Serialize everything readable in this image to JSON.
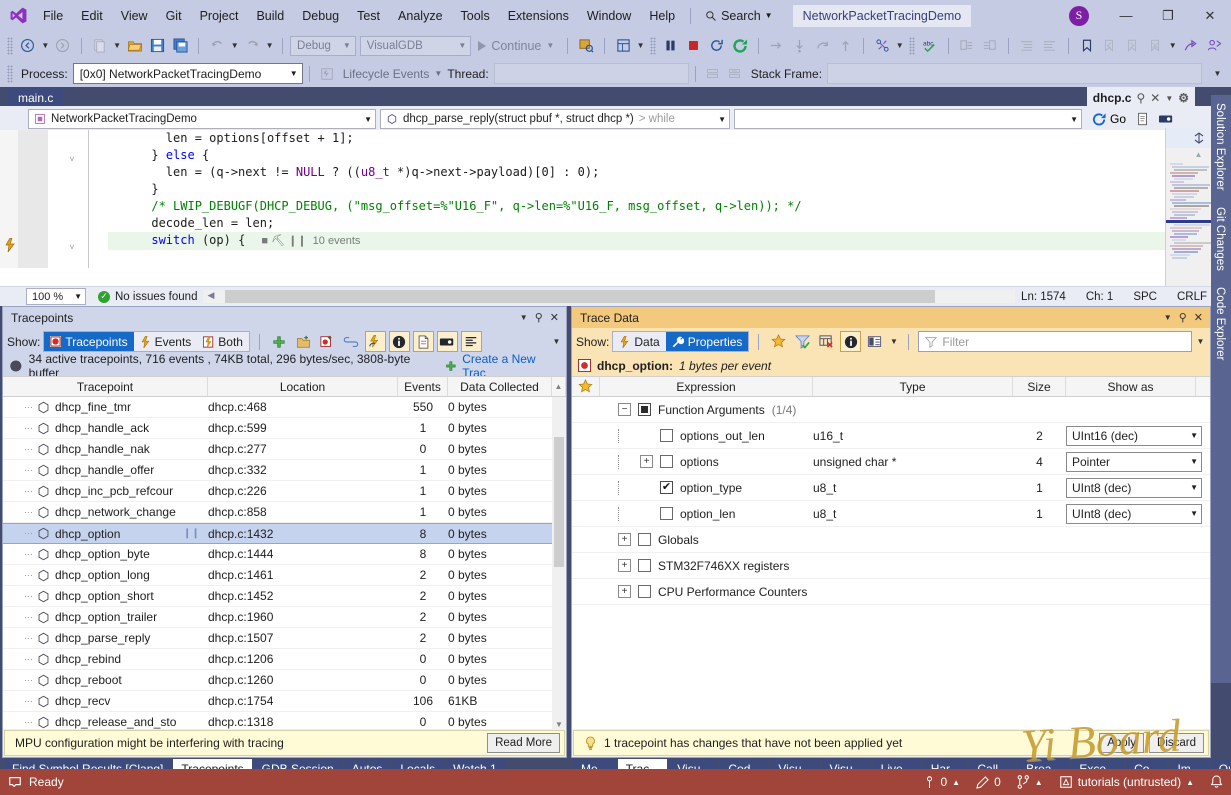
{
  "window": {
    "title": "NetworkPacketTracingDemo",
    "avatar_initial": "S",
    "minimize": "—",
    "restore": "❐",
    "close": "✕"
  },
  "menu": {
    "items": [
      "File",
      "Edit",
      "View",
      "Git",
      "Project",
      "Build",
      "Debug",
      "Test",
      "Analyze",
      "Tools",
      "Extensions",
      "Window",
      "Help"
    ],
    "search_label": "Search"
  },
  "toolbar": {
    "config": "Debug",
    "platform": "VisualGDB",
    "continue_label": "Continue",
    "icons": [
      "back-icon",
      "forward-icon",
      "new-item-icon",
      "open-file-icon",
      "save-icon",
      "save-all-icon",
      "undo-icon",
      "redo-icon",
      "pause-icon",
      "stop-icon",
      "restart-icon",
      "refresh-icon",
      "step-over-icon",
      "step-into-icon",
      "step-out-icon",
      "step-up-icon",
      "thread-icon",
      "spell-check-icon",
      "indent-icon",
      "outdent-icon",
      "comment-icon",
      "uncomment-icon",
      "bookmark-icon",
      "bookmark-prev-icon",
      "bookmark-next-icon",
      "bookmark-clear-icon",
      "share-icon",
      "live-share-icon"
    ]
  },
  "debug_bar": {
    "process_label": "Process:",
    "process_value": "[0x0] NetworkPacketTracingDemo",
    "lifecycle_label": "Lifecycle Events",
    "thread_label": "Thread:",
    "stack_frame_label": "Stack Frame:"
  },
  "editor": {
    "tabs": [
      {
        "label": "main.c",
        "active": true
      }
    ],
    "right_tab": "dhcp.c",
    "scope_project": "NetworkPacketTracingDemo",
    "scope_function": "dhcp_parse_reply(struct pbuf *, struct dhcp *)",
    "scope_suffix": "> while",
    "go_label": "Go",
    "code_lines": [
      {
        "indent": 8,
        "parts": [
          {
            "t": "len = options[offset + 1];",
            "c": ""
          }
        ]
      },
      {
        "indent": 6,
        "parts": [
          {
            "t": "} ",
            "c": ""
          },
          {
            "t": "else",
            "c": "kw"
          },
          {
            "t": " {",
            "c": ""
          }
        ]
      },
      {
        "indent": 8,
        "parts": [
          {
            "t": "len = (q->next != ",
            "c": ""
          },
          {
            "t": "NULL",
            "c": "macro"
          },
          {
            "t": " ? ((",
            "c": ""
          },
          {
            "t": "u8_t",
            "c": "macro"
          },
          {
            "t": " *)q->next->payload)[0] : 0);",
            "c": ""
          }
        ]
      },
      {
        "indent": 6,
        "parts": [
          {
            "t": "}",
            "c": ""
          }
        ]
      },
      {
        "indent": 6,
        "parts": [
          {
            "t": "/* LWIP_DEBUGF(DHCP_DEBUG, (\"msg_offset=%\"U16_F\", q->len=%\"U16_F, msg_offset, q->len)); */",
            "c": "cmt"
          }
        ]
      },
      {
        "indent": 6,
        "parts": [
          {
            "t": "decode_len = len;",
            "c": ""
          }
        ]
      },
      {
        "indent": 6,
        "highlight": true,
        "parts": [
          {
            "t": "switch",
            "c": "kw"
          },
          {
            "t": " (op) {",
            "c": ""
          }
        ]
      }
    ],
    "inline_events": "10 events",
    "zoom": "100 %",
    "issues": "No issues found",
    "ln": "Ln: 1574",
    "ch": "Ch: 1",
    "spaces": "SPC",
    "eol": "CRLF"
  },
  "tracepoints_panel": {
    "title": "Tracepoints",
    "show_label": "Show:",
    "segments": [
      {
        "label": "Tracepoints",
        "icon": "tracepoint-icon",
        "active": true
      },
      {
        "label": "Events",
        "icon": "lightning-icon",
        "active": false
      },
      {
        "label": "Both",
        "icon": "both-icon",
        "active": false
      }
    ],
    "toolbar_icons": [
      "add-tracepoint-icon",
      "new-group-icon",
      "import-tracepoint-icon",
      "link-icon",
      "apply-changes-icon",
      "info-icon",
      "file-icon",
      "label-icon",
      "list-icon"
    ],
    "summary": "34 active tracepoints, 716 events , 74KB total, 296 bytes/sec, 3808-byte buffer",
    "create_link": "Create a New Trac",
    "columns": [
      "Tracepoint",
      "Location",
      "Events",
      "Data Collected"
    ],
    "rows": [
      {
        "name": "dhcp_fine_tmr",
        "location": "dhcp.c:468",
        "events": "550",
        "data": "0 bytes",
        "selected": false
      },
      {
        "name": "dhcp_handle_ack",
        "location": "dhcp.c:599",
        "events": "1",
        "data": "0 bytes",
        "selected": false
      },
      {
        "name": "dhcp_handle_nak",
        "location": "dhcp.c:277",
        "events": "0",
        "data": "0 bytes",
        "selected": false
      },
      {
        "name": "dhcp_handle_offer",
        "location": "dhcp.c:332",
        "events": "1",
        "data": "0 bytes",
        "selected": false
      },
      {
        "name": "dhcp_inc_pcb_refcour",
        "location": "dhcp.c:226",
        "events": "1",
        "data": "0 bytes",
        "selected": false
      },
      {
        "name": "dhcp_network_change",
        "location": "dhcp.c:858",
        "events": "1",
        "data": "0 bytes",
        "selected": false
      },
      {
        "name": "dhcp_option",
        "location": "dhcp.c:1432",
        "events": "8",
        "data": "0 bytes",
        "selected": true,
        "modified": true
      },
      {
        "name": "dhcp_option_byte",
        "location": "dhcp.c:1444",
        "events": "8",
        "data": "0 bytes",
        "selected": false
      },
      {
        "name": "dhcp_option_long",
        "location": "dhcp.c:1461",
        "events": "2",
        "data": "0 bytes",
        "selected": false
      },
      {
        "name": "dhcp_option_short",
        "location": "dhcp.c:1452",
        "events": "2",
        "data": "0 bytes",
        "selected": false
      },
      {
        "name": "dhcp_option_trailer",
        "location": "dhcp.c:1960",
        "events": "2",
        "data": "0 bytes",
        "selected": false
      },
      {
        "name": "dhcp_parse_reply",
        "location": "dhcp.c:1507",
        "events": "2",
        "data": "0 bytes",
        "selected": false
      },
      {
        "name": "dhcp_rebind",
        "location": "dhcp.c:1206",
        "events": "0",
        "data": "0 bytes",
        "selected": false
      },
      {
        "name": "dhcp_reboot",
        "location": "dhcp.c:1260",
        "events": "0",
        "data": "0 bytes",
        "selected": false
      },
      {
        "name": "dhcp_recv",
        "location": "dhcp.c:1754",
        "events": "106",
        "data": "61KB",
        "selected": false
      },
      {
        "name": "dhcp_release_and_sto",
        "location": "dhcp.c:1318",
        "events": "0",
        "data": "0 bytes",
        "selected": false
      }
    ],
    "notice": "MPU configuration might be interfering with tracing",
    "notice_button": "Read More",
    "bottom_tabs": [
      {
        "label": "Find Symbol Results [Clang]",
        "active": false
      },
      {
        "label": "Tracepoints",
        "active": true
      },
      {
        "label": "GDB Session",
        "active": false
      },
      {
        "label": "Autos",
        "active": false
      },
      {
        "label": "Locals",
        "active": false
      },
      {
        "label": "Watch 1",
        "active": false
      }
    ]
  },
  "trace_data_panel": {
    "title": "Trace Data",
    "show_label": "Show:",
    "segments": [
      {
        "label": "Data",
        "icon": "lightning-icon",
        "active": false
      },
      {
        "label": "Properties",
        "icon": "wrench-icon",
        "active": true
      }
    ],
    "toolbar_icons": [
      "favorite-icon",
      "filter-icon",
      "table-clear-icon",
      "info-icon",
      "columns-icon"
    ],
    "filter_placeholder": "Filter",
    "subject_name": "dhcp_option:",
    "subject_detail": "1 bytes per event",
    "columns": [
      "Expression",
      "Type",
      "Size",
      "Show as"
    ],
    "star_column": "favorite-icon",
    "rows": [
      {
        "depth": 0,
        "expander": "minus",
        "checkbox": "partial",
        "expression": "Function Arguments",
        "suffix": "(1/4)",
        "type": "",
        "size": "",
        "showas": null
      },
      {
        "depth": 1,
        "expander": "none",
        "checkbox": "unchecked",
        "expression": "options_out_len",
        "type": "u16_t",
        "size": "2",
        "showas": "UInt16 (dec)"
      },
      {
        "depth": 1,
        "expander": "plus",
        "checkbox": "unchecked",
        "expression": "options",
        "type": "unsigned char *",
        "size": "4",
        "showas": "Pointer"
      },
      {
        "depth": 1,
        "expander": "none",
        "checkbox": "checked",
        "expression": "option_type",
        "type": "u8_t",
        "size": "1",
        "showas": "UInt8 (dec)"
      },
      {
        "depth": 1,
        "expander": "none",
        "checkbox": "unchecked",
        "expression": "option_len",
        "type": "u8_t",
        "size": "1",
        "showas": "UInt8 (dec)"
      },
      {
        "depth": 0,
        "expander": "plus",
        "checkbox": "unchecked",
        "expression": "Globals",
        "type": "",
        "size": "",
        "showas": null
      },
      {
        "depth": 0,
        "expander": "plus",
        "checkbox": "unchecked",
        "expression": "STM32F746XX registers",
        "type": "",
        "size": "",
        "showas": null
      },
      {
        "depth": 0,
        "expander": "plus",
        "checkbox": "unchecked",
        "expression": "CPU Performance Counters",
        "type": "",
        "size": "",
        "showas": null
      }
    ],
    "notice": "1 tracepoint has changes that have not been applied yet",
    "apply_button": "Apply",
    "discard_button": "Discard",
    "bottom_tabs": [
      {
        "label": "Me...",
        "active": false
      },
      {
        "label": "Trac...",
        "active": true
      },
      {
        "label": "Visu...",
        "active": false
      },
      {
        "label": "Cod...",
        "active": false
      },
      {
        "label": "Visu...",
        "active": false
      },
      {
        "label": "Visu...",
        "active": false
      },
      {
        "label": "Live...",
        "active": false
      },
      {
        "label": "Har...",
        "active": false
      },
      {
        "label": "Call...",
        "active": false
      },
      {
        "label": "Brea...",
        "active": false
      },
      {
        "label": "Exce...",
        "active": false
      },
      {
        "label": "Co...",
        "active": false
      },
      {
        "label": "Im...",
        "active": false
      },
      {
        "label": "Out...",
        "active": false
      }
    ]
  },
  "right_sidebar": {
    "tabs": [
      "Solution Explorer",
      "Git Changes",
      "Code Explorer"
    ]
  },
  "statusbar": {
    "ready": "Ready",
    "errors": "0",
    "edits": "0",
    "repo": "tutorials (untrusted)"
  },
  "watermark": "Yi Board",
  "colors": {
    "accent_blue": "#1569c7",
    "titlebar": "#c5cbe2",
    "status_red": "#a1453b",
    "panel_amber": "#f2c97d",
    "chrome_navy": "#434c6e"
  }
}
